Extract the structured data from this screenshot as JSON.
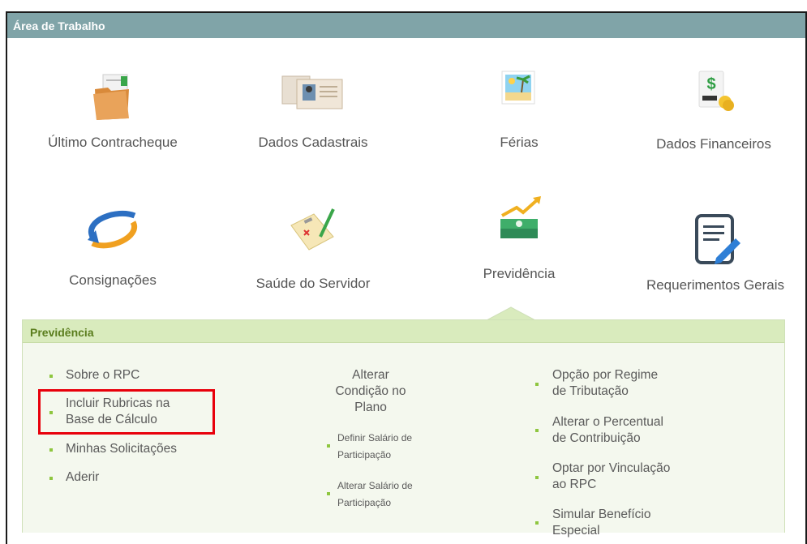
{
  "header": {
    "title": "Área de Trabalho"
  },
  "tiles": {
    "contracheque": "Último Contracheque",
    "dados_cadastrais": "Dados Cadastrais",
    "ferias": "Férias",
    "dados_financeiros": "Dados Financeiros",
    "consignacoes": "Consignações",
    "saude": "Saúde do Servidor",
    "previdencia": "Previdência",
    "requerimentos": "Requerimentos Gerais"
  },
  "panel": {
    "title": "Previdência",
    "col1": [
      "Sobre o RPC",
      "Incluir Rubricas na",
      "Base de Cálculo",
      "Minhas Solicitações",
      "Aderir"
    ],
    "col2": {
      "heading": [
        "Alterar",
        "Condição no",
        "Plano"
      ],
      "items": [
        "Definir Salário de",
        "Participação",
        "Alterar Salário de",
        "Participação"
      ]
    },
    "col3": [
      "Opção por Regime",
      "de Tributação",
      "Alterar o Percentual",
      "de Contribuição",
      "Optar por Vinculação",
      "ao RPC",
      "Simular Benefício",
      "Especial"
    ]
  }
}
